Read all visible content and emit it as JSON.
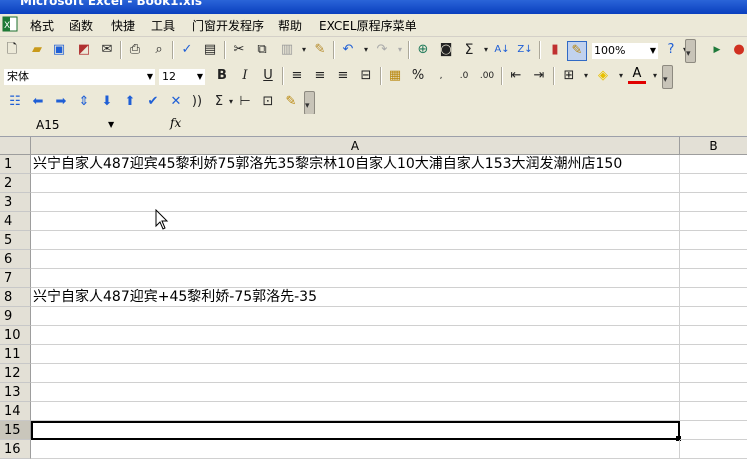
{
  "window": {
    "title": "Microsoft Excel - Book1.xls"
  },
  "menu": [
    "格式",
    "函数",
    "快捷",
    "工具",
    "门窗开发程序",
    "帮助",
    "EXCEL原程序菜单"
  ],
  "toolbar1": {
    "zoom": "100%"
  },
  "toolbar2": {
    "font_name": "宋体",
    "font_size": "12",
    "bold": "B",
    "italic": "I",
    "underline": "U",
    "percent": "%",
    "text_color_letter": "A"
  },
  "toolbar3": {
    "sigma_label": "Σ"
  },
  "formula_bar": {
    "name_box": "A15",
    "fx_label": "fx",
    "content": ""
  },
  "sheet": {
    "columns": [
      "A",
      "B"
    ],
    "rows": [
      {
        "num": "1",
        "a": "兴宁自家人487迎宾45黎利娇75郭洛先35黎宗林10自家人10大浦自家人153大润发潮州店150"
      },
      {
        "num": "2",
        "a": ""
      },
      {
        "num": "3",
        "a": ""
      },
      {
        "num": "4",
        "a": ""
      },
      {
        "num": "5",
        "a": ""
      },
      {
        "num": "6",
        "a": ""
      },
      {
        "num": "7",
        "a": ""
      },
      {
        "num": "8",
        "a": "兴宁自家人487迎宾+45黎利娇-75郭洛先-35"
      },
      {
        "num": "9",
        "a": ""
      },
      {
        "num": "10",
        "a": ""
      },
      {
        "num": "11",
        "a": ""
      },
      {
        "num": "12",
        "a": ""
      },
      {
        "num": "13",
        "a": ""
      },
      {
        "num": "14",
        "a": ""
      },
      {
        "num": "15",
        "a": ""
      },
      {
        "num": "16",
        "a": ""
      }
    ],
    "active_cell": "A15"
  },
  "colors": {
    "face": "#ece9d8",
    "header": "#e3e0d6",
    "accent": "#1f5fd6"
  }
}
